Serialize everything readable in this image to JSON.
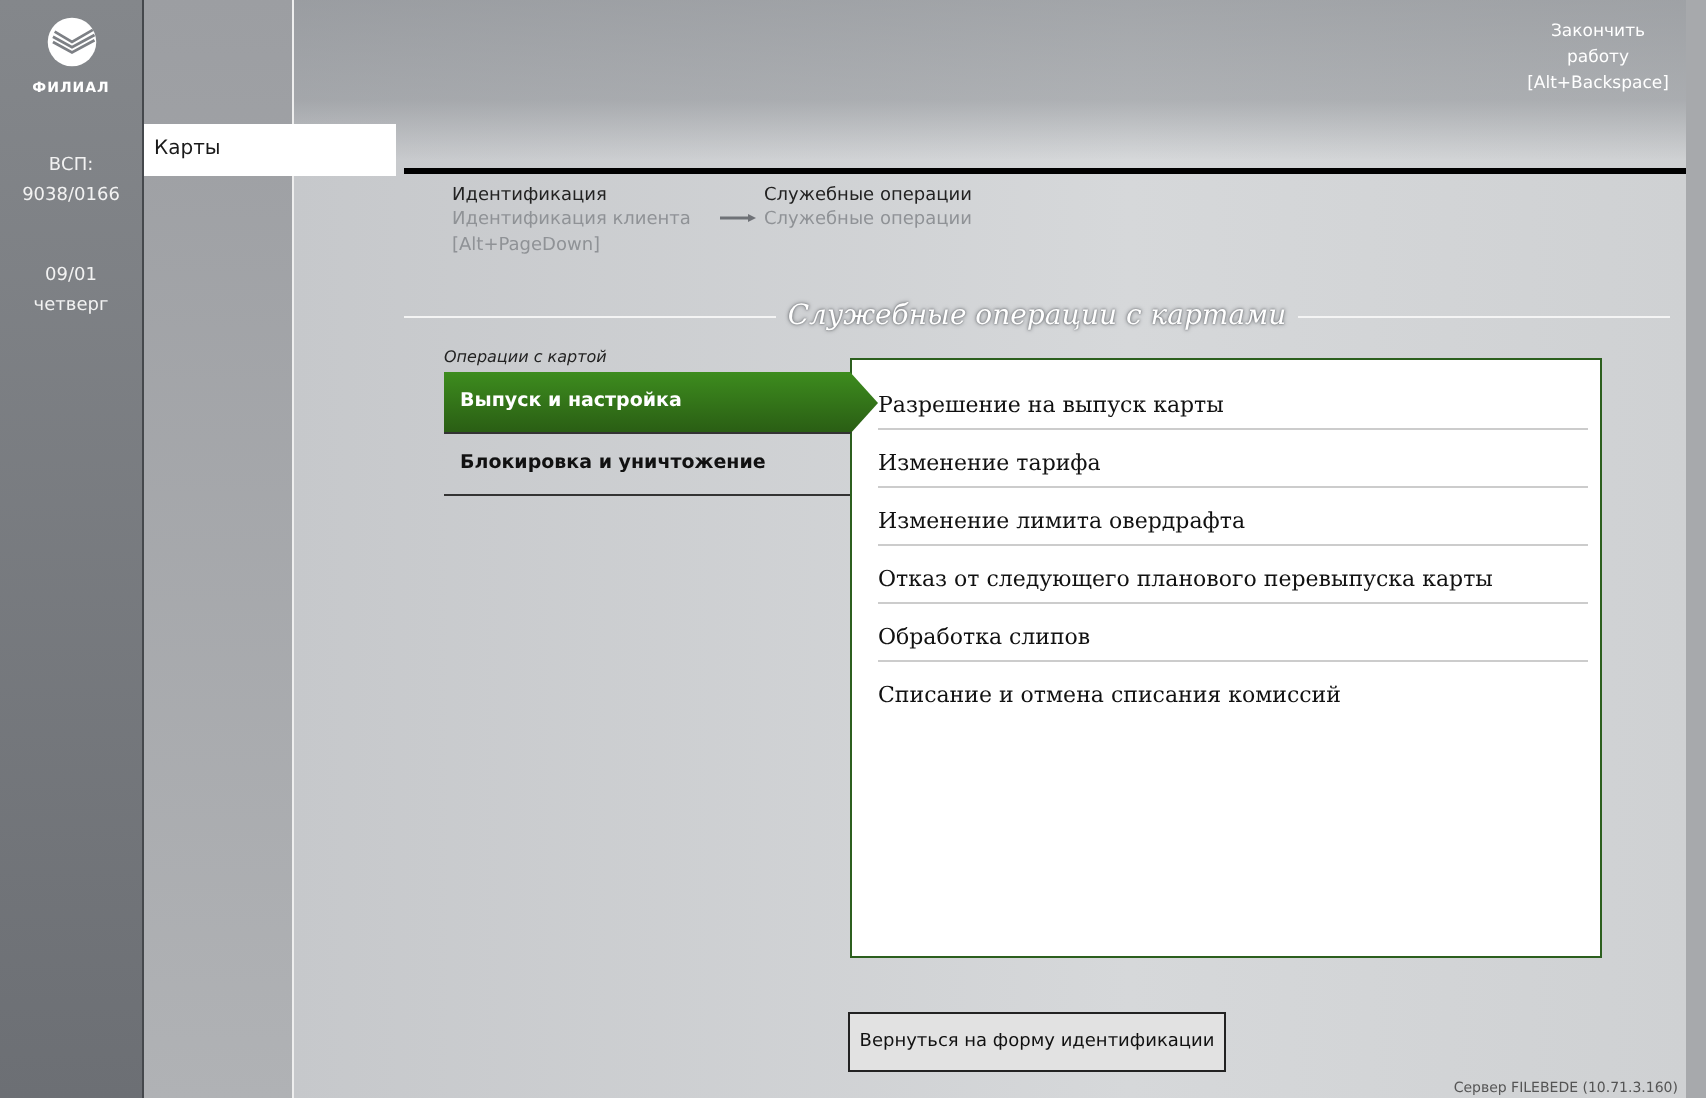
{
  "brand": {
    "name": "ФИЛИАЛ"
  },
  "branch": {
    "label": "ВСП:",
    "code": "9038/0166"
  },
  "date": {
    "day": "09/01",
    "weekday": "четверг"
  },
  "nav": [
    {
      "label": "Карты",
      "selected": true
    }
  ],
  "exit": {
    "lines": [
      "Закончить",
      "работу",
      "[Alt+Backspace]"
    ]
  },
  "breadcrumbs": [
    {
      "title": "Идентификация",
      "subtitle": "Идентификация клиента",
      "hotkey": "[Alt+PageDown]",
      "arrow": false
    },
    {
      "title": "Служебные операции",
      "subtitle": "Служебные операции",
      "arrow": true
    }
  ],
  "section_title": "Служебные операции с картами",
  "menu": {
    "caption": "Операции с картой",
    "items": [
      {
        "label": "Выпуск и настройка",
        "selected": true
      },
      {
        "label": "Блокировка и уничтожение",
        "selected": false
      }
    ]
  },
  "operations": [
    "Разрешение на выпуск карты",
    "Изменение тарифа",
    "Изменение лимита овердрафта",
    "Отказ от следующего планового перевыпуска карты",
    "Обработка слипов",
    "Списание и отмена списания комиссий"
  ],
  "back_button": "Вернуться на форму идентификации",
  "server": "Сервер FILEBEDE (10.71.3.160)"
}
